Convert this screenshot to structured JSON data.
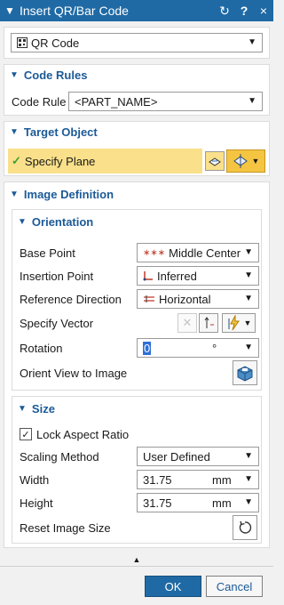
{
  "window": {
    "title": "Insert QR/Bar Code"
  },
  "type_select": {
    "value": "QR Code"
  },
  "code_rules": {
    "header": "Code Rules",
    "label": "Code Rule",
    "value": "<PART_NAME>"
  },
  "target_object": {
    "header": "Target Object",
    "label": "Specify Plane"
  },
  "image_definition": {
    "header": "Image Definition",
    "orientation": {
      "header": "Orientation",
      "base_point": {
        "label": "Base Point",
        "value": "Middle Center"
      },
      "insertion_point": {
        "label": "Insertion Point",
        "value": "Inferred"
      },
      "reference_direction": {
        "label": "Reference Direction",
        "value": "Horizontal"
      },
      "specify_vector": {
        "label": "Specify Vector"
      },
      "rotation": {
        "label": "Rotation",
        "value": "0",
        "unit": "°"
      },
      "orient_view": {
        "label": "Orient View to Image"
      }
    },
    "size": {
      "header": "Size",
      "lock_aspect": {
        "label": "Lock Aspect Ratio",
        "checked": true
      },
      "scaling_method": {
        "label": "Scaling Method",
        "value": "User Defined"
      },
      "width": {
        "label": "Width",
        "value": "31.75",
        "unit": "mm"
      },
      "height": {
        "label": "Height",
        "value": "31.75",
        "unit": "mm"
      },
      "reset": {
        "label": "Reset Image Size"
      }
    }
  },
  "buttons": {
    "ok": "OK",
    "cancel": "Cancel"
  },
  "colors": {
    "title_bar": "#1f6aa5",
    "section_header": "#1b5a97",
    "highlight": "#fae08a",
    "check": "#3aa135"
  }
}
